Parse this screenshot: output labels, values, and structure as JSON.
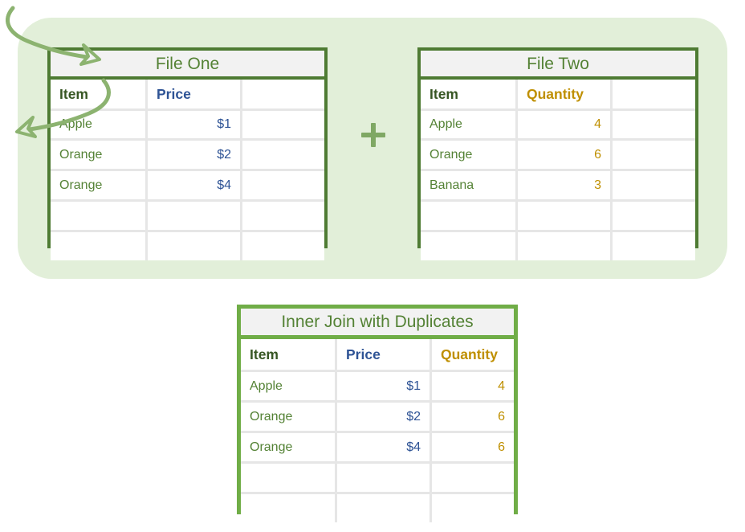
{
  "diagram": {
    "panel_color": "#e2efd9",
    "source_border_color": "#4e7b33",
    "result_border_color": "#70ad47",
    "arrow_color": "#8cb370",
    "plus_label": "+",
    "plus_color": "#7fa864",
    "item_color": "#548235",
    "price_color": "#2e5395",
    "quantity_color": "#bf8f00"
  },
  "tables": {
    "file_one": {
      "title": "File One",
      "headers": [
        "Item",
        "Price",
        ""
      ],
      "rows": [
        [
          "Apple",
          "$1",
          ""
        ],
        [
          "Orange",
          "$2",
          ""
        ],
        [
          "Orange",
          "$4",
          ""
        ],
        [
          "",
          "",
          ""
        ],
        [
          "",
          "",
          ""
        ]
      ]
    },
    "file_two": {
      "title": "File Two",
      "headers": [
        "Item",
        "Quantity",
        ""
      ],
      "rows": [
        [
          "Apple",
          "4",
          ""
        ],
        [
          "Orange",
          "6",
          ""
        ],
        [
          "Banana",
          "3",
          ""
        ],
        [
          "",
          "",
          ""
        ],
        [
          "",
          "",
          ""
        ]
      ]
    },
    "result": {
      "title": "Inner Join with Duplicates",
      "headers": [
        "Item",
        "Price",
        "Quantity"
      ],
      "rows": [
        [
          "Apple",
          "$1",
          "4"
        ],
        [
          "Orange",
          "$2",
          "6"
        ],
        [
          "Orange",
          "$4",
          "6"
        ],
        [
          "",
          "",
          ""
        ],
        [
          "",
          "",
          ""
        ]
      ]
    }
  }
}
